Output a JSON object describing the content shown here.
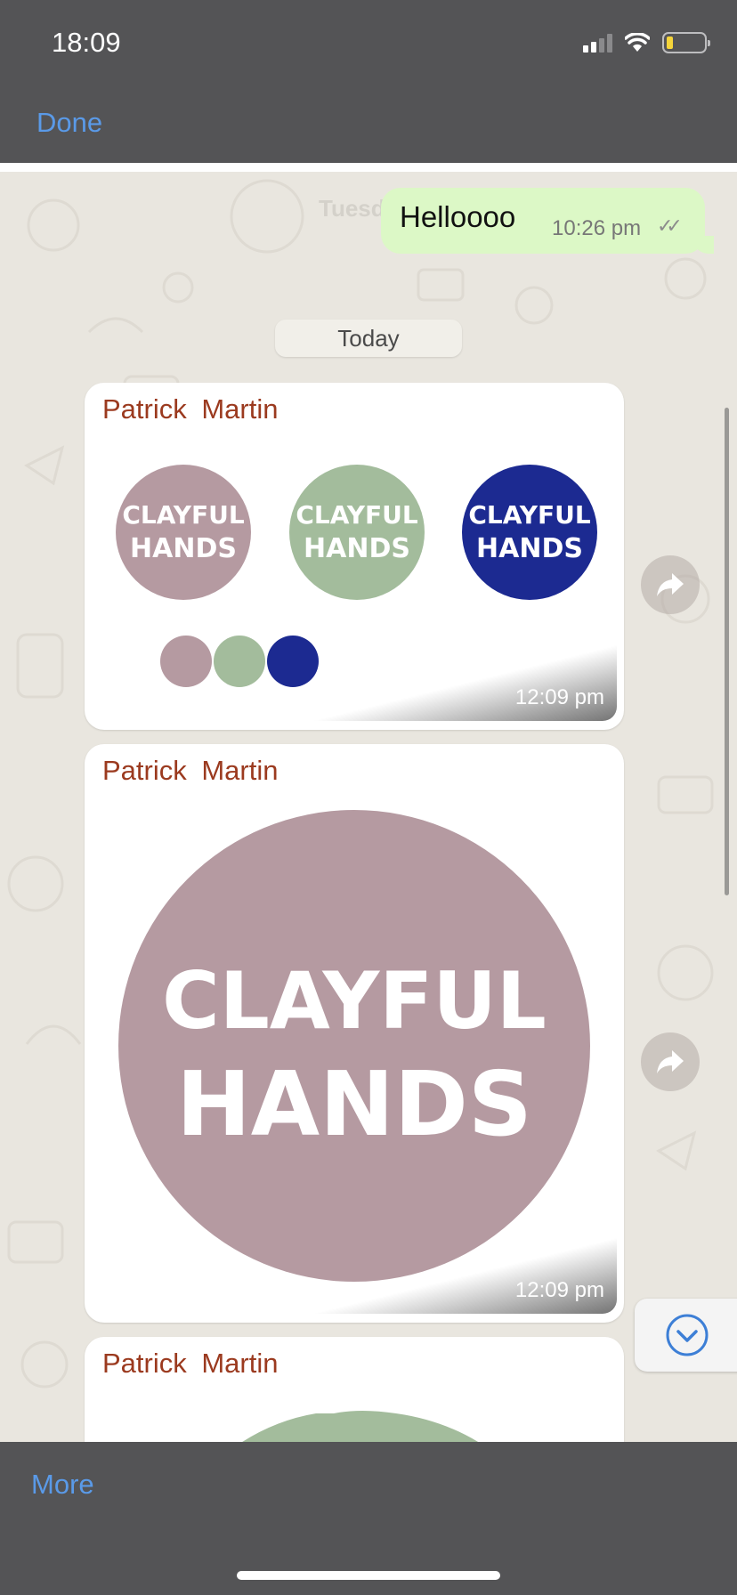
{
  "status_bar": {
    "time": "18:09"
  },
  "nav": {
    "done_label": "Done"
  },
  "chat": {
    "outgoing": {
      "text": "Helloooo",
      "time": "10:26 pm",
      "ticks": "✓✓"
    },
    "ghost_date": "Tuesda",
    "date_chip": "Today",
    "messages": [
      {
        "sender": "Patrick  Martin",
        "time": "12:09 pm",
        "logo_text": [
          "CLAYFUL",
          "HANDS"
        ]
      },
      {
        "sender": "Patrick  Martin",
        "time": "12:09 pm",
        "logo_text": [
          "CLAYFUL",
          "HANDS"
        ]
      },
      {
        "sender": "Patrick  Martin"
      }
    ],
    "palette": {
      "mauve": "#b59aa1",
      "sage": "#a3bc9c",
      "navy": "#1c2a91"
    }
  },
  "toolbar": {
    "more_label": "More"
  },
  "colors": {
    "accent": "#5a9ae8",
    "sender_name": "#9b3a1f",
    "bubble_out": "#dcf8c6",
    "bars": "#545456"
  }
}
